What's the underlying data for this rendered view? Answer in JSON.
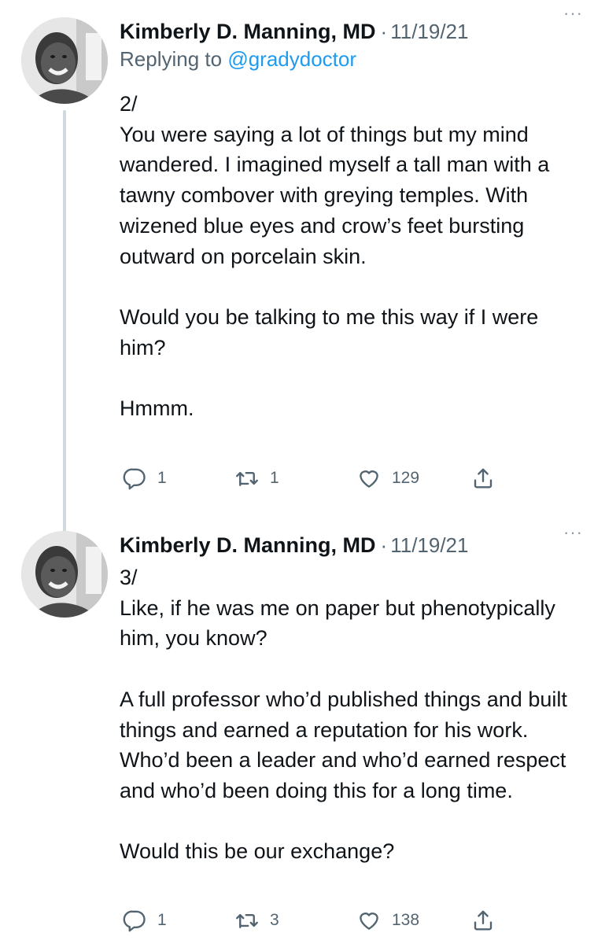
{
  "tweets": [
    {
      "author": "Kimberly D. Manning, MD",
      "separator": "·",
      "date": "11/19/21",
      "more": "···",
      "replying_prefix": "Replying to",
      "replying_handle": "@gradydoctor",
      "paragraphs": [
        "2/\nYou were saying a lot of things but my mind wandered. I imagined myself a tall man with a tawny combover with greying temples. With wizened blue eyes and crow’s feet bursting outward on porcelain skin.",
        "Would you be talking to me this way if I were him?",
        "Hmmm."
      ],
      "replies": "1",
      "retweets": "1",
      "likes": "129"
    },
    {
      "author": "Kimberly D. Manning, MD",
      "separator": "·",
      "date": "11/19/21",
      "more": "···",
      "paragraphs": [
        "3/\nLike, if he was me on paper but phenotypically him, you know?",
        "A full professor who’d published things and built things and earned a reputation for his work. Who’d been a leader and who’d earned respect and who’d been doing this for a long time.",
        "Would this be our exchange?"
      ],
      "replies": "1",
      "retweets": "3",
      "likes": "138"
    }
  ],
  "icons": {
    "reply": "reply-icon",
    "retweet": "retweet-icon",
    "like": "heart-icon",
    "share": "share-icon",
    "more": "more-icon"
  },
  "colors": {
    "text": "#0f1419",
    "secondary": "#536471",
    "link": "#1d9bf0",
    "thread_line": "#cfd9de"
  }
}
